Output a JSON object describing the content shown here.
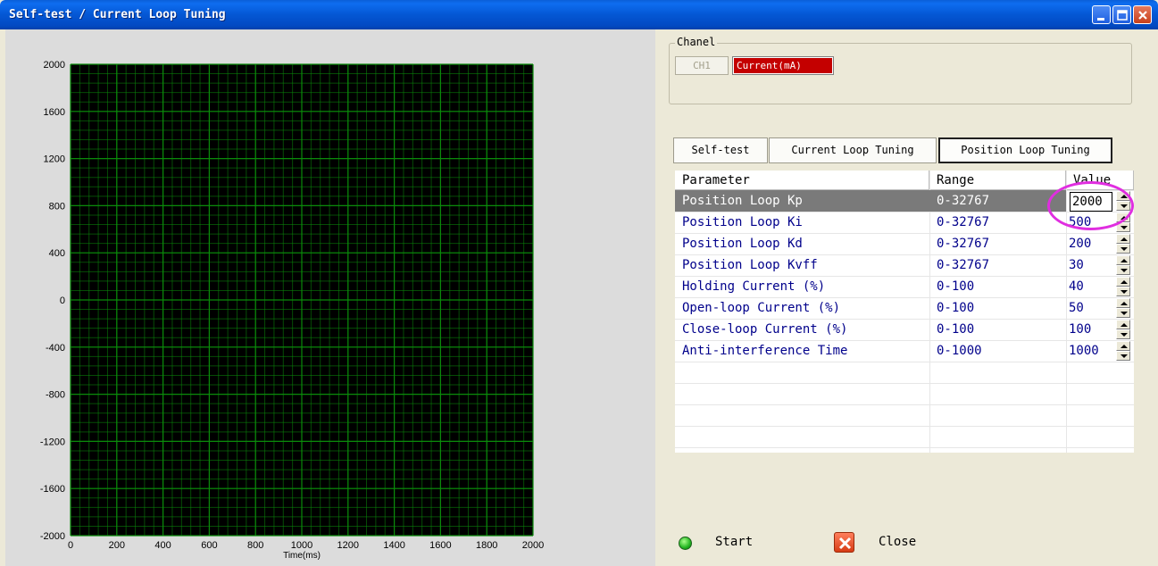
{
  "window": {
    "title": "Self-test / Current Loop Tuning"
  },
  "channel": {
    "group_label": "Chanel",
    "ch1_label": "CH1",
    "current_label": "Current(mA)"
  },
  "tabs": [
    {
      "label": "Self-test",
      "active": false
    },
    {
      "label": "Current Loop Tuning",
      "active": false
    },
    {
      "label": "Position Loop Tuning",
      "active": true
    }
  ],
  "table": {
    "headers": [
      "Parameter",
      "Range",
      "Value"
    ],
    "rows": [
      {
        "param": "Position Loop Kp",
        "range": "0-32767",
        "value": "2000"
      },
      {
        "param": "Position Loop Ki",
        "range": "0-32767",
        "value": "500"
      },
      {
        "param": "Position Loop Kd",
        "range": "0-32767",
        "value": "200"
      },
      {
        "param": "Position Loop Kvff",
        "range": "0-32767",
        "value": "30"
      },
      {
        "param": "Holding Current (%)",
        "range": "0-100",
        "value": "40"
      },
      {
        "param": "Open-loop Current (%)",
        "range": "0-100",
        "value": "50"
      },
      {
        "param": "Close-loop Current (%)",
        "range": "0-100",
        "value": "100"
      },
      {
        "param": "Anti-interference Time",
        "range": "0-1000",
        "value": "1000"
      }
    ]
  },
  "buttons": {
    "start_label": "Start",
    "close_label": "Close"
  },
  "colors": {
    "plot_bg": "#000000",
    "grid_line": "#0b8a0b",
    "highlight": "#e02ee0",
    "channel_red": "#c40000"
  },
  "chart_data": {
    "type": "line",
    "xlabel": "Time(ms)",
    "ylabel": "",
    "xlim": [
      0,
      2000
    ],
    "ylim": [
      -2000,
      2000
    ],
    "x_ticks": [
      0,
      200,
      400,
      600,
      800,
      1000,
      1200,
      1400,
      1600,
      1800,
      2000
    ],
    "y_ticks": [
      2000,
      1600,
      1200,
      800,
      400,
      0,
      -400,
      -800,
      -1200,
      -1600,
      -2000
    ],
    "series": [],
    "grid": true
  }
}
